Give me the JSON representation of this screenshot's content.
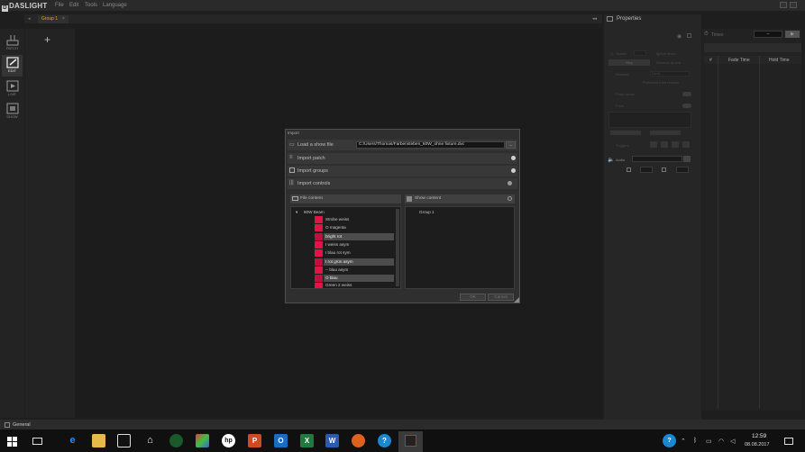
{
  "app": {
    "name": "DASLIGHT",
    "menu": [
      "File",
      "Edit",
      "Tools",
      "Language"
    ]
  },
  "toolbar": {
    "tools": [
      {
        "label": "PATCH",
        "icon": "patch-icon"
      },
      {
        "label": "EDIT",
        "icon": "edit-icon",
        "active": true
      },
      {
        "label": "LIVE",
        "icon": "live-icon"
      },
      {
        "label": "SHOW",
        "icon": "show-icon"
      }
    ]
  },
  "tabs": {
    "active": "Group 1",
    "add_symbol": "+"
  },
  "properties": {
    "title": "Properties",
    "times_label": "Times",
    "times_value": "--",
    "speed_label": "Speed",
    "step_label": "Step",
    "ignore_times_label": "Ignore times",
    "reverse_at_end_label": "Reverse at end",
    "release_label": "Release",
    "release_value": "Nicht",
    "protected_label": "Protected from release",
    "flash_label": "Flash mode",
    "fade_label": "Fade",
    "triggers_label": "Triggers",
    "audio_label": "Audio"
  },
  "steps": {
    "columns": [
      "#",
      "Fade Time",
      "Hold Time"
    ]
  },
  "dialog": {
    "title": "Import",
    "load_label": "Load a show file",
    "path_value": "C:/Users/Thomas/Farbensteben_60W_ohne fixture.dvc",
    "browse_label": "...",
    "import_patch_label": "Import patch",
    "import_groups_label": "Import groups",
    "import_controls_label": "Import controls",
    "file_content_label": "File content",
    "show_content_label": "Show content",
    "file_tree_root": "60W Beam",
    "file_items": [
      {
        "label": "Strobe weiss",
        "selected": false
      },
      {
        "label": "O magenta",
        "selected": false
      },
      {
        "label": "bright rot",
        "selected": true
      },
      {
        "label": "I weiss asym",
        "selected": false
      },
      {
        "label": "I blau rot sym",
        "selected": false
      },
      {
        "label": "I rot grün asym",
        "selected": true
      },
      {
        "label": "-- blau asym",
        "selected": false
      },
      {
        "label": "O blau",
        "selected": true
      },
      {
        "label": "Green 2 weiss",
        "selected": false
      }
    ],
    "show_items": [
      "Group 1"
    ],
    "ok_label": "OK",
    "cancel_label": "Cancel"
  },
  "status": {
    "tab_label": "General"
  },
  "taskbar": {
    "time": "12:59",
    "date": "08.08.2017"
  }
}
